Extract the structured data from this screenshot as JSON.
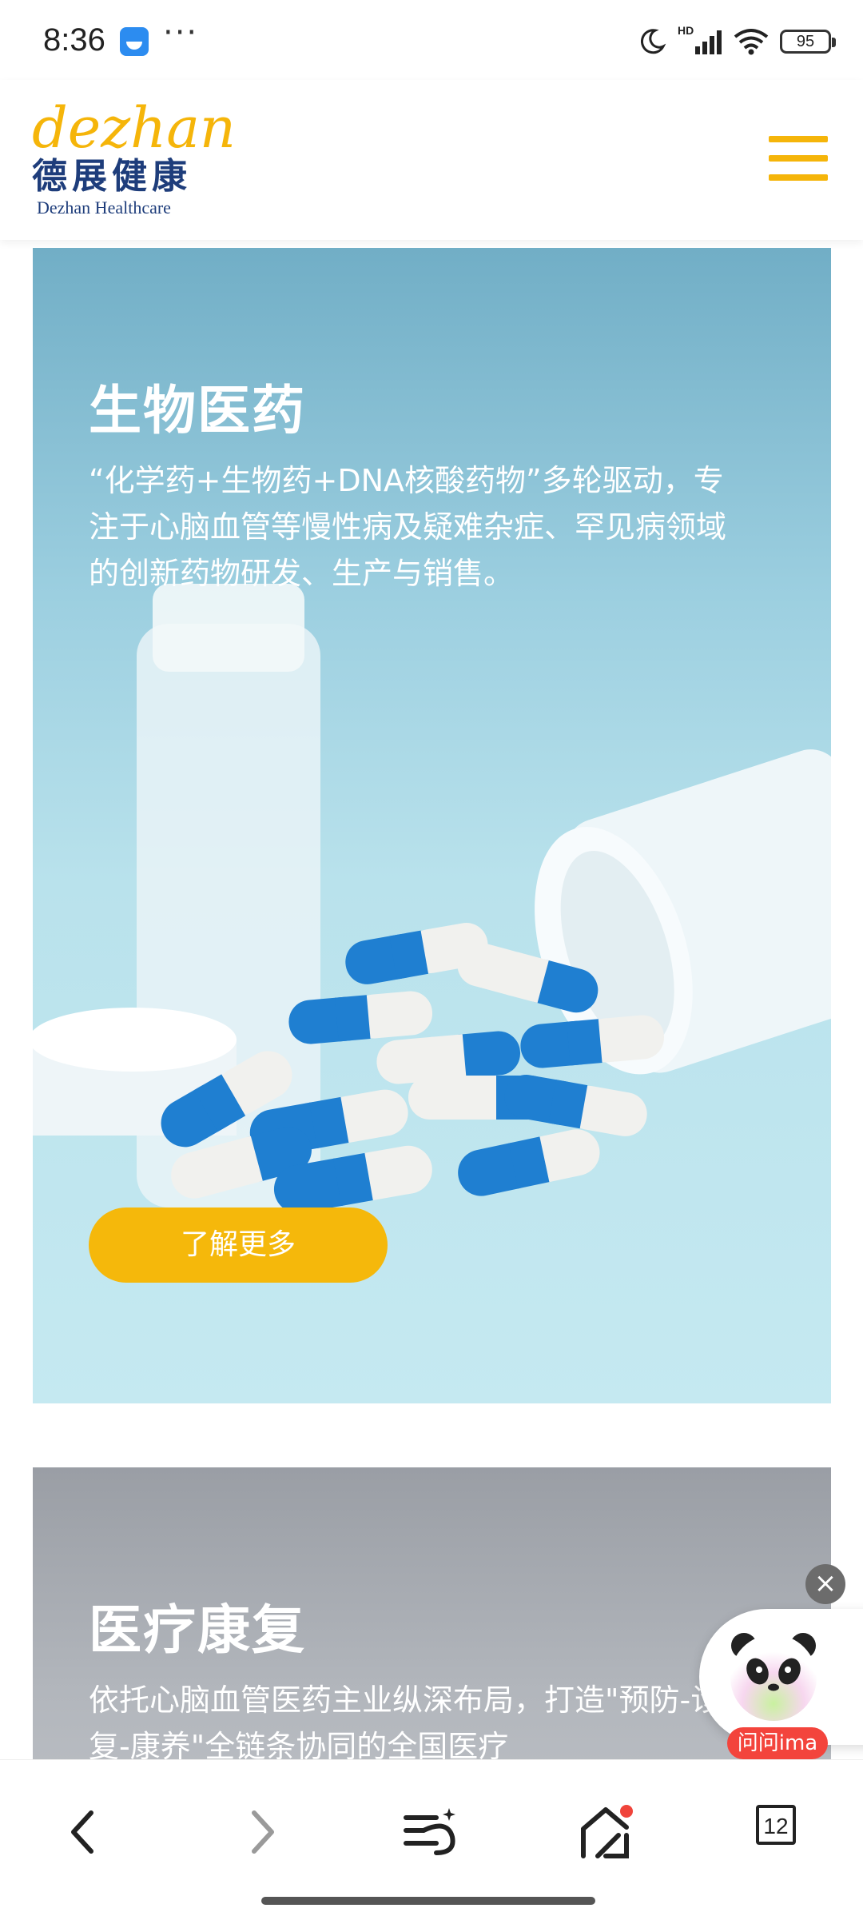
{
  "status_bar": {
    "time": "8:36",
    "more": "···",
    "network": "HD",
    "battery": "95"
  },
  "header": {
    "logo_script": "dezhan",
    "logo_cn": "德展健康",
    "logo_en": "Dezhan Healthcare",
    "menu_icon": "hamburger-icon",
    "accent_color": "#f5b50a",
    "brand_color": "#1e3d7b"
  },
  "cards": [
    {
      "title": "生物医药",
      "description": "“化学药+生物药+DNA核酸药物”多轮驱动，专注于心脑血管等慢性病及疑难杂症、罕见病领域的创新药物研发、生产与销售。",
      "button_label": "了解更多"
    },
    {
      "title": "医疗康复",
      "description": "依托心脑血管医药主业纵深布局，打造\"预防-诊疗-康复-康养\"全链条协同的全国医疗"
    }
  ],
  "assistant": {
    "label": "问问ima",
    "close_icon": "close-icon"
  },
  "bottom_nav": {
    "back_icon": "chevron-left-icon",
    "forward_icon": "chevron-right-icon",
    "ai_icon": "ai-sparkle-icon",
    "home_icon": "home-icon",
    "tabs_count": "12"
  }
}
